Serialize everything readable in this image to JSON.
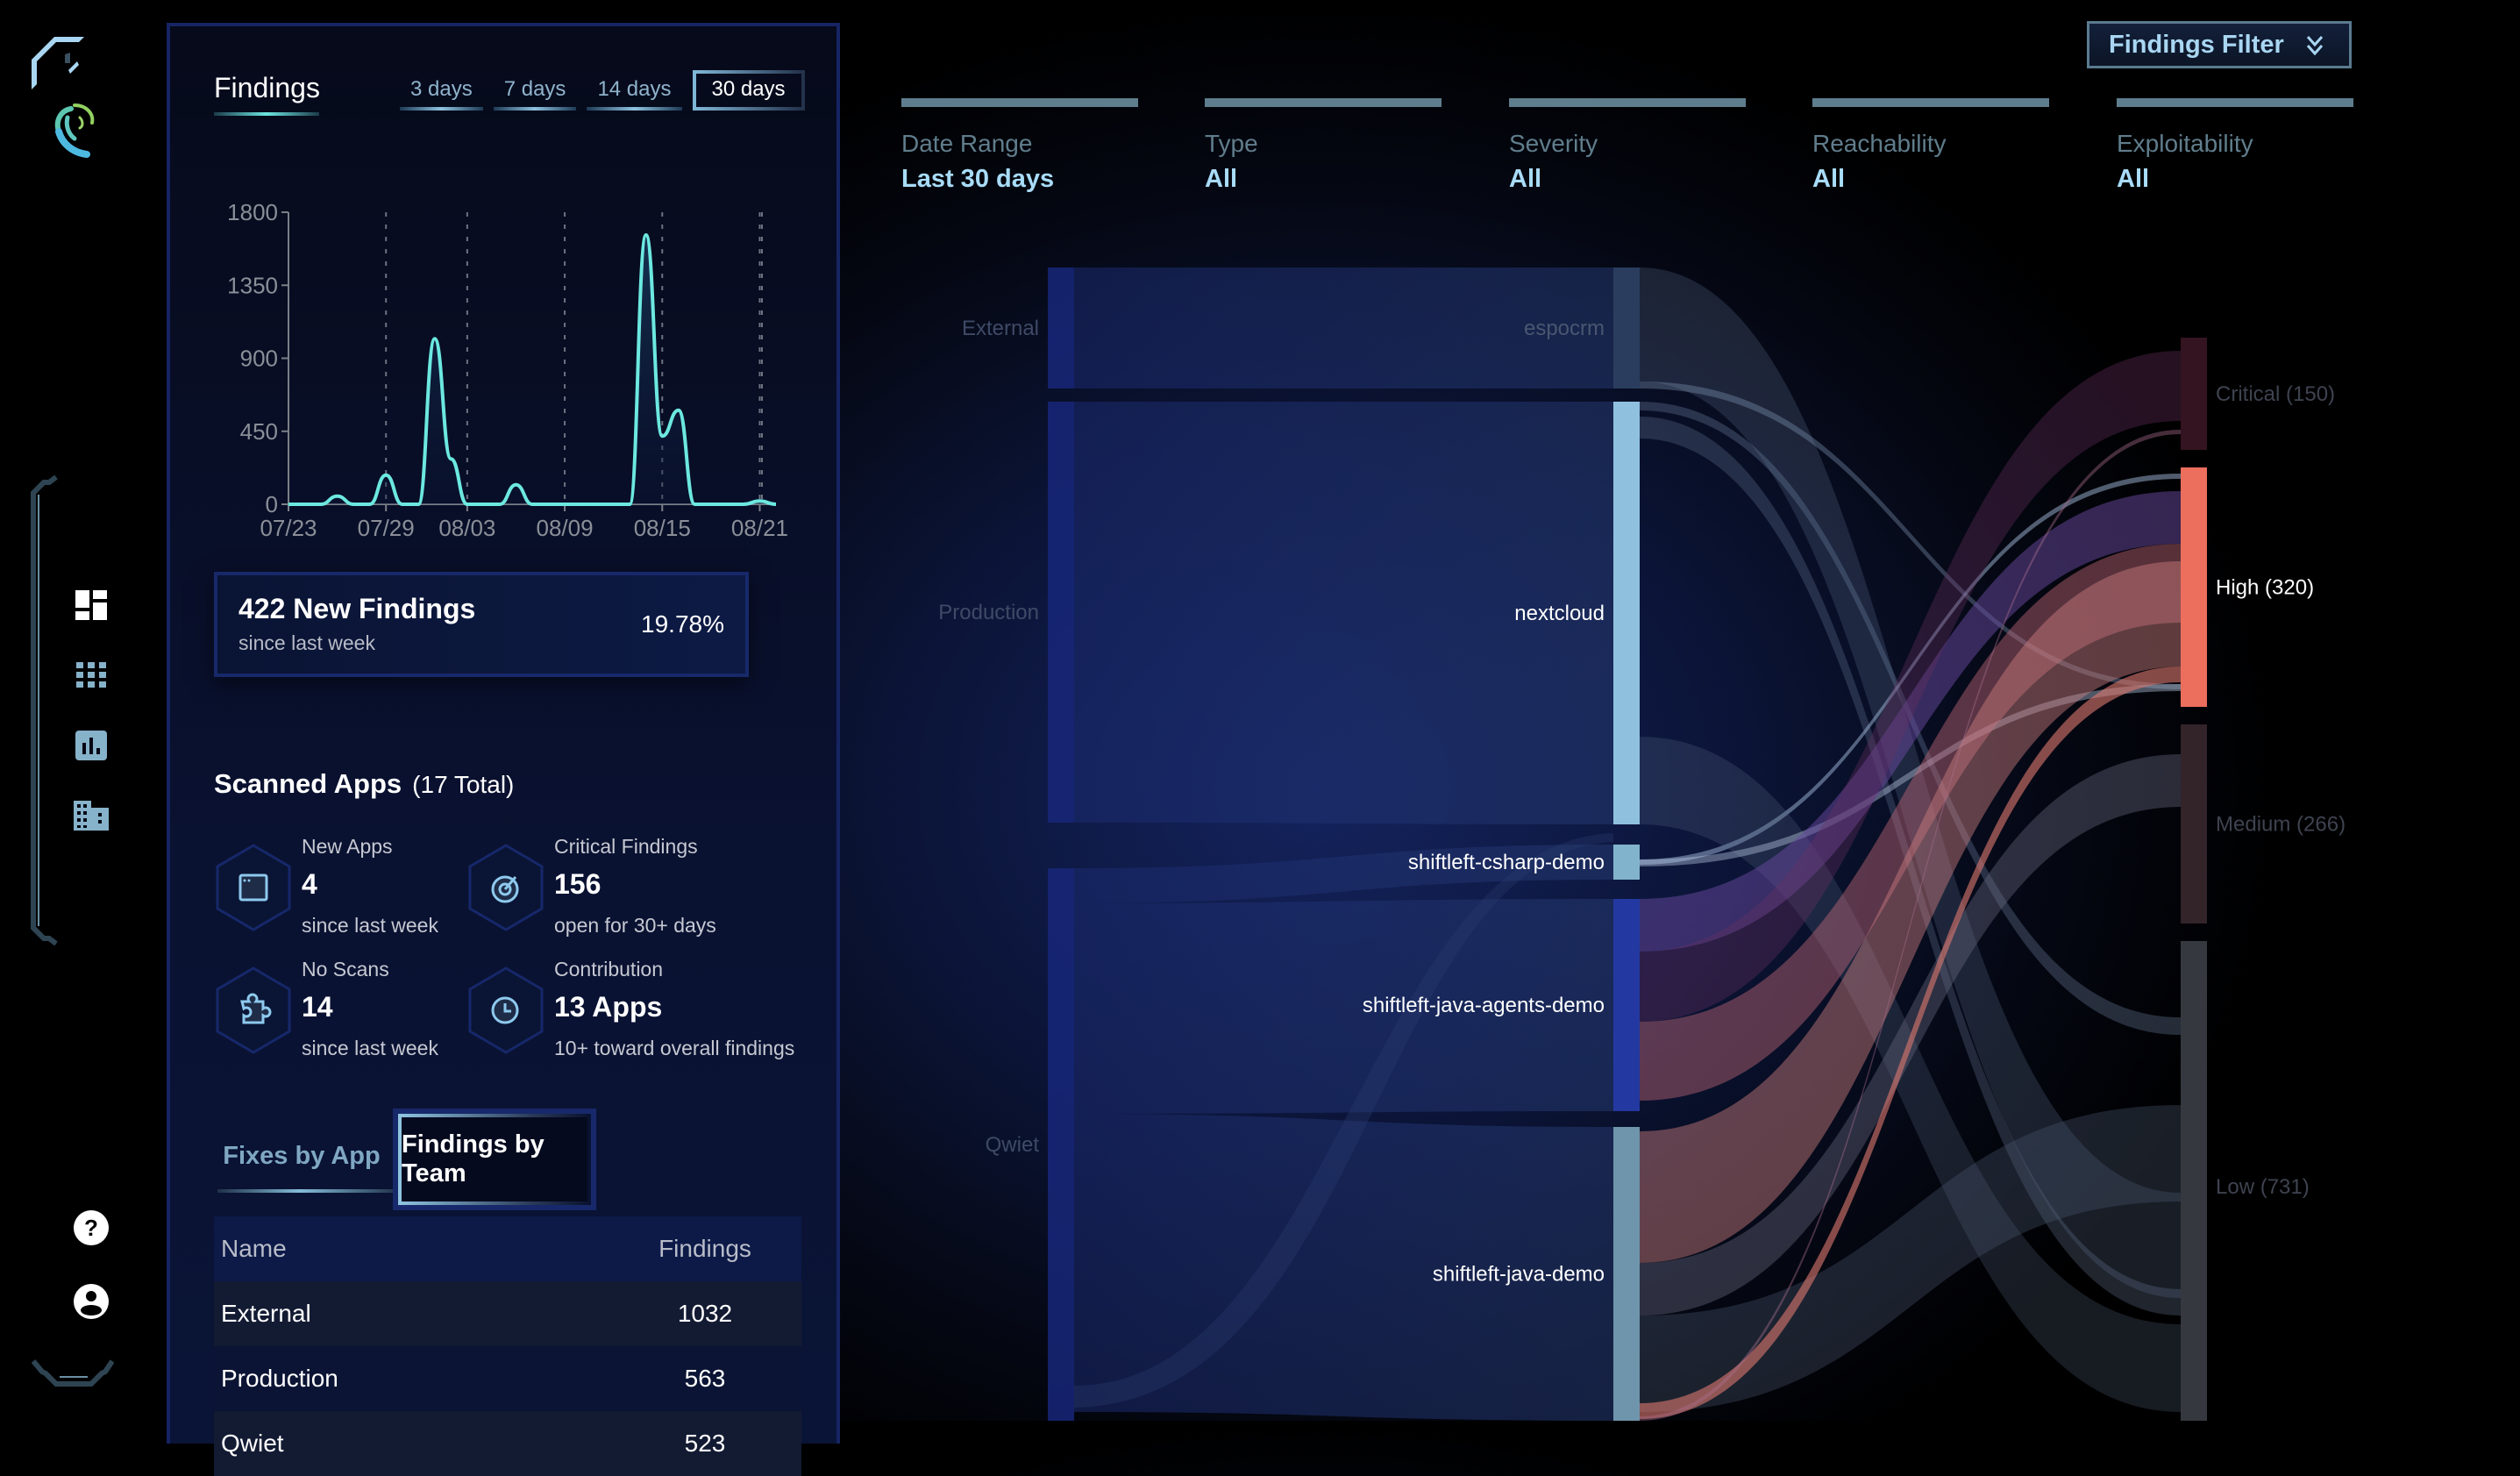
{
  "nav": {
    "items": [
      {
        "name": "dashboard",
        "icon": "dashboard-icon",
        "active": true
      },
      {
        "name": "apps",
        "icon": "apps-grid-icon",
        "active": false
      },
      {
        "name": "reports",
        "icon": "bar-chart-icon",
        "active": false
      },
      {
        "name": "organizations",
        "icon": "building-icon",
        "active": false
      }
    ],
    "bottom": [
      {
        "name": "help",
        "icon": "help-icon"
      },
      {
        "name": "account",
        "icon": "account-icon"
      }
    ]
  },
  "findings_panel": {
    "title": "Findings",
    "range_tabs": [
      "3 days",
      "7 days",
      "14 days",
      "30 days"
    ],
    "active_range": "30 days",
    "new_findings": {
      "title": "422 New Findings",
      "subtitle": "since last week",
      "percent": "19.78%"
    }
  },
  "chart_data": {
    "type": "line",
    "title": "Findings",
    "xlabel": "",
    "ylabel": "",
    "x_ticks": [
      "07/23",
      "07/29",
      "08/03",
      "08/09",
      "08/15",
      "08/21"
    ],
    "y_ticks": [
      0,
      450,
      900,
      1350,
      1800
    ],
    "ylim": [
      0,
      1800
    ],
    "x_days": [
      "07/23",
      "07/24",
      "07/25",
      "07/26",
      "07/27",
      "07/28",
      "07/29",
      "07/30",
      "07/31",
      "08/01",
      "08/02",
      "08/03",
      "08/04",
      "08/05",
      "08/06",
      "08/07",
      "08/08",
      "08/09",
      "08/10",
      "08/11",
      "08/12",
      "08/13",
      "08/14",
      "08/15",
      "08/16",
      "08/17",
      "08/18",
      "08/19",
      "08/20",
      "08/21",
      "08/22"
    ],
    "values": [
      0,
      0,
      0,
      50,
      0,
      0,
      180,
      0,
      0,
      1020,
      280,
      0,
      0,
      0,
      120,
      0,
      0,
      0,
      0,
      0,
      0,
      0,
      1660,
      420,
      580,
      0,
      0,
      0,
      0,
      20,
      0
    ],
    "grid": "vertical-dotted",
    "color": "#6ce8e0"
  },
  "scanned_apps": {
    "title": "Scanned Apps",
    "count_label": "(17 Total)",
    "stats": [
      {
        "label": "New Apps",
        "value": "4",
        "sub": "since last week",
        "icon": "app-window-icon"
      },
      {
        "label": "Critical Findings",
        "value": "156",
        "sub": "open for 30+ days",
        "icon": "target-icon"
      },
      {
        "label": "No Scans",
        "value": "14",
        "sub": "since last week",
        "icon": "puzzle-icon"
      },
      {
        "label": "Contribution",
        "value": "13 Apps",
        "sub": "10+ toward overall findings",
        "icon": "clock-icon"
      }
    ]
  },
  "team_tabs": {
    "tabs": [
      "Fixes by App",
      "Findings by Team"
    ],
    "active": "Findings by Team"
  },
  "team_table": {
    "headers": [
      "Name",
      "Findings"
    ],
    "rows": [
      {
        "name": "External",
        "findings": "1032"
      },
      {
        "name": "Production",
        "findings": "563"
      },
      {
        "name": "Qwiet",
        "findings": "523"
      }
    ]
  },
  "filters": {
    "button_label": "Findings Filter",
    "items": [
      {
        "label": "Date Range",
        "value": "Last 30 days"
      },
      {
        "label": "Type",
        "value": "All"
      },
      {
        "label": "Severity",
        "value": "All"
      },
      {
        "label": "Reachability",
        "value": "All"
      },
      {
        "label": "Exploitability",
        "value": "All"
      }
    ]
  },
  "sankey": {
    "teams": [
      {
        "name": "External",
        "value": 1032,
        "highlight": false
      },
      {
        "name": "Production",
        "value": 563,
        "highlight": false
      },
      {
        "name": "Qwiet",
        "value": 523,
        "highlight": false
      }
    ],
    "apps": [
      {
        "name": "espocrm",
        "value": 200,
        "highlight": false,
        "color": "#2a3d5e"
      },
      {
        "name": "nextcloud",
        "value": 710,
        "highlight": true,
        "color": "#8fc1df"
      },
      {
        "name": "shiftleft-csharp-demo",
        "value": 55,
        "highlight": true,
        "color": "#82b3cd"
      },
      {
        "name": "shiftleft-java-agents-demo",
        "value": 355,
        "highlight": true,
        "color": "#2338a0"
      },
      {
        "name": "shiftleft-java-demo",
        "value": 570,
        "highlight": true,
        "color": "#6e95ab"
      }
    ],
    "severities": [
      {
        "name": "Critical (150)",
        "value": 150,
        "highlight": false,
        "color": "#341420"
      },
      {
        "name": "High (320)",
        "value": 320,
        "highlight": true,
        "color": "#ec6e5d"
      },
      {
        "name": "Medium (266)",
        "value": 266,
        "highlight": false,
        "color": "#33242a"
      },
      {
        "name": "Low (731)",
        "value": 731,
        "highlight": false,
        "color": "#35383e"
      }
    ]
  }
}
